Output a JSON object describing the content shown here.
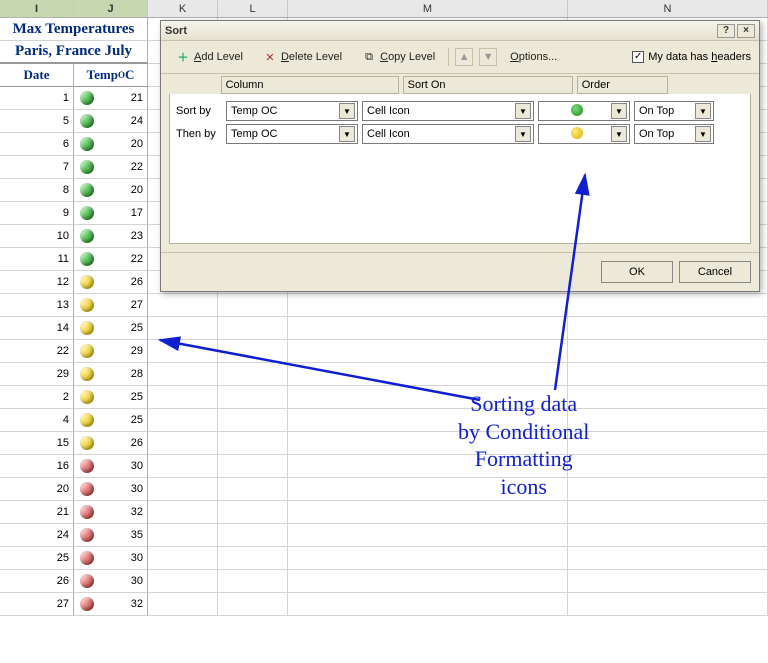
{
  "columns": {
    "I": "I",
    "J": "J",
    "K": "K",
    "L": "L",
    "M": "M",
    "N": "N"
  },
  "sheet": {
    "title1": "Max Temperatures",
    "title2": "Paris, France July",
    "hdr_date": "Date",
    "hdr_temp_prefix": "Temp ",
    "hdr_temp_sup": "O",
    "hdr_temp_unit": "C",
    "rows": [
      {
        "date": 1,
        "temp": 21,
        "icon": "green"
      },
      {
        "date": 5,
        "temp": 24,
        "icon": "green"
      },
      {
        "date": 6,
        "temp": 20,
        "icon": "green"
      },
      {
        "date": 7,
        "temp": 22,
        "icon": "green"
      },
      {
        "date": 8,
        "temp": 20,
        "icon": "green"
      },
      {
        "date": 9,
        "temp": 17,
        "icon": "green"
      },
      {
        "date": 10,
        "temp": 23,
        "icon": "green"
      },
      {
        "date": 11,
        "temp": 22,
        "icon": "green"
      },
      {
        "date": 12,
        "temp": 26,
        "icon": "yellow"
      },
      {
        "date": 13,
        "temp": 27,
        "icon": "yellow"
      },
      {
        "date": 14,
        "temp": 25,
        "icon": "yellow"
      },
      {
        "date": 22,
        "temp": 29,
        "icon": "yellow"
      },
      {
        "date": 29,
        "temp": 28,
        "icon": "yellow"
      },
      {
        "date": 2,
        "temp": 25,
        "icon": "yellow"
      },
      {
        "date": 4,
        "temp": 25,
        "icon": "yellow"
      },
      {
        "date": 15,
        "temp": 26,
        "icon": "yellow"
      },
      {
        "date": 16,
        "temp": 30,
        "icon": "red"
      },
      {
        "date": 20,
        "temp": 30,
        "icon": "red"
      },
      {
        "date": 21,
        "temp": 32,
        "icon": "red"
      },
      {
        "date": 24,
        "temp": 35,
        "icon": "red"
      },
      {
        "date": 25,
        "temp": 30,
        "icon": "red"
      },
      {
        "date": 26,
        "temp": 30,
        "icon": "red"
      },
      {
        "date": 27,
        "temp": 32,
        "icon": "red"
      }
    ]
  },
  "dialog": {
    "title": "Sort",
    "toolbar": {
      "add_level": "Add Level",
      "delete_level": "Delete Level",
      "copy_level": "Copy Level",
      "options": "Options...",
      "headers_label": "My data has headers",
      "headers_checked": true
    },
    "headers": {
      "column": "Column",
      "sorton": "Sort On",
      "order": "Order"
    },
    "rows": [
      {
        "label": "Sort by",
        "column": "Temp OC",
        "sorton": "Cell Icon",
        "order_icon": "green",
        "placement": "On Top"
      },
      {
        "label": "Then by",
        "column": "Temp OC",
        "sorton": "Cell Icon",
        "order_icon": "yellow",
        "placement": "On Top"
      }
    ],
    "buttons": {
      "ok": "OK",
      "cancel": "Cancel"
    }
  },
  "annotation": {
    "line1": "Sorting data",
    "line2": "by Conditional",
    "line3": "Formatting",
    "line4": "icons"
  }
}
